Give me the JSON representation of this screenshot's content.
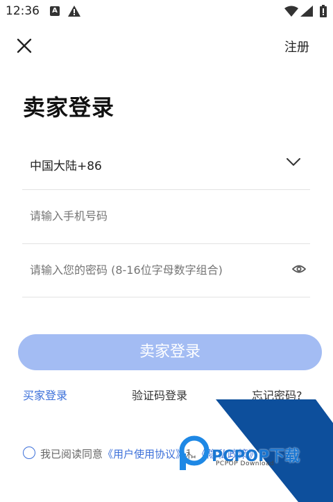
{
  "status_bar": {
    "time": "12:36",
    "notification_letter": "A"
  },
  "header": {
    "register_label": "注册"
  },
  "title": "卖家登录",
  "form": {
    "country": "中国大陆+86",
    "phone_placeholder": "请输入手机号码",
    "password_placeholder": "请输入您的密码 (8-16位字母数字组合)"
  },
  "login_button_label": "卖家登录",
  "links": {
    "buyer_login": "买家登录",
    "code_login": "验证码登录",
    "forgot_password": "忘记密码?"
  },
  "agreement": {
    "prefix": "我已阅读同意",
    "user_agreement": "《用户使用协议》",
    "middle": "和",
    "privacy": "《隐私政策》"
  },
  "watermark": {
    "brand": "PCPOP下载",
    "sub": "PCPOP Download"
  },
  "colors": {
    "accent": "#3b6fd9",
    "button_disabled": "#a3bcf3",
    "watermark_blue": "#0d4f9c"
  }
}
